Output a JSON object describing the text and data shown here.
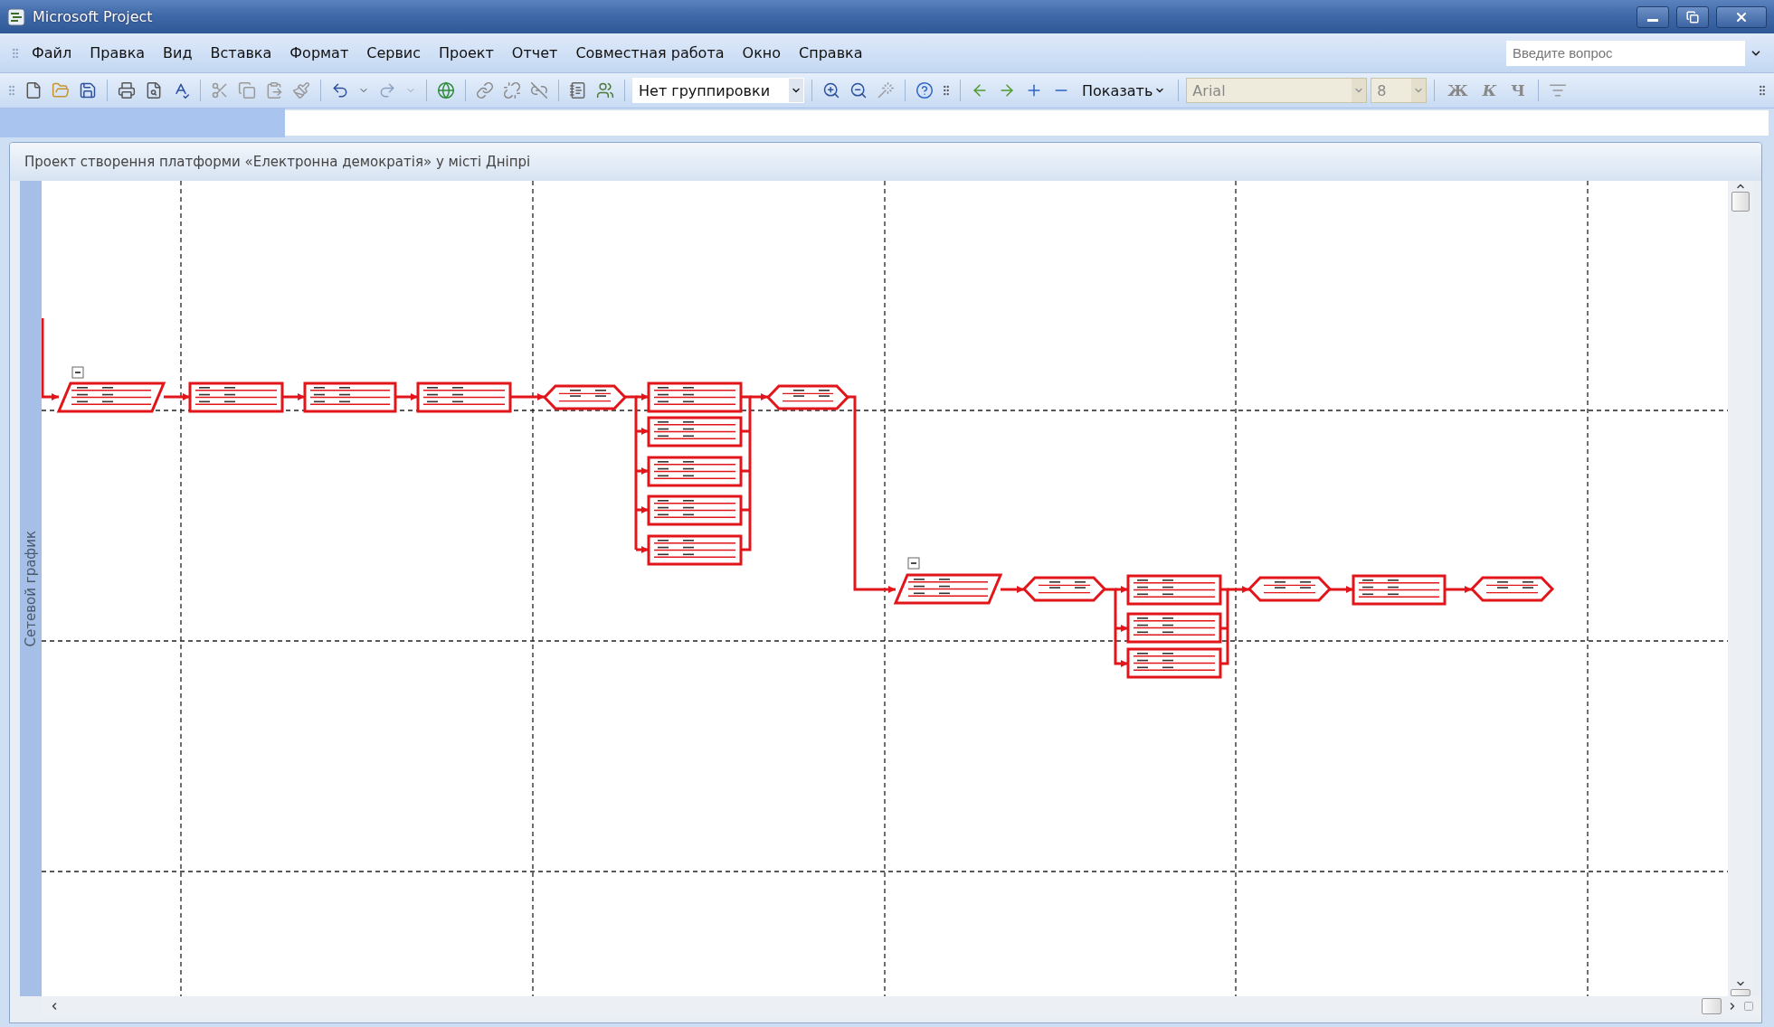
{
  "window": {
    "title": "Microsoft Project"
  },
  "menu": [
    "Файл",
    "Правка",
    "Вид",
    "Вставка",
    "Формат",
    "Сервис",
    "Проект",
    "Отчет",
    "Совместная работа",
    "Окно",
    "Справка"
  ],
  "help_search": {
    "placeholder": "Введите вопрос"
  },
  "toolbar": {
    "group_by": "Нет группировки",
    "show_button": "Показать",
    "font": "Arial",
    "font_size": "8",
    "format_buttons": [
      "Ж",
      "К",
      "Ч"
    ]
  },
  "document": {
    "title": "Проект створення платформи «Електронна демократія» у місті Дніпрі",
    "view_label": "Сетевой график",
    "network": {
      "nodes": [
        {
          "kind": "summary"
        },
        {
          "kind": "task"
        },
        {
          "kind": "task"
        },
        {
          "kind": "task"
        },
        {
          "kind": "milestone"
        },
        {
          "kind": "task"
        },
        {
          "kind": "task"
        },
        {
          "kind": "task"
        },
        {
          "kind": "task"
        },
        {
          "kind": "task"
        },
        {
          "kind": "milestone"
        },
        {
          "kind": "summary"
        },
        {
          "kind": "milestone"
        },
        {
          "kind": "task"
        },
        {
          "kind": "task"
        },
        {
          "kind": "task"
        },
        {
          "kind": "milestone"
        },
        {
          "kind": "task"
        },
        {
          "kind": "milestone"
        }
      ]
    }
  }
}
